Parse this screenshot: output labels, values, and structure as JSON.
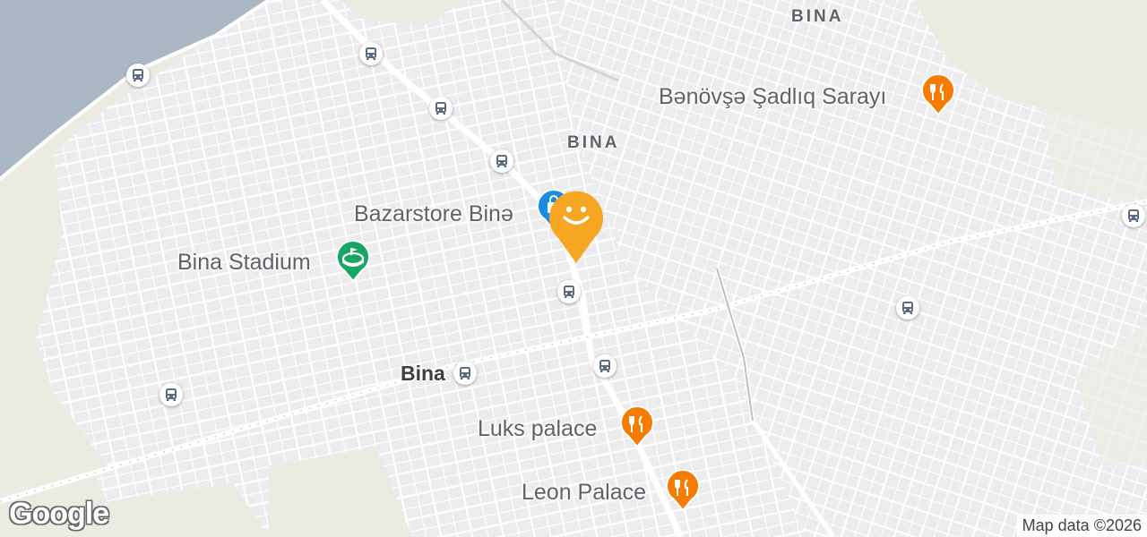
{
  "map": {
    "place_labels": {
      "bazarstore": "Bazarstore Binə",
      "stadium": "Bina Stadium",
      "banovse": "Bənövşə Şadlıq Sarayı",
      "luks": "Luks palace",
      "leon": "Leon Palace"
    },
    "area_labels": {
      "bina_north": "BINA",
      "bina_center": "BINA"
    },
    "station_label": "Bina",
    "icons": {
      "bus": "bus-stop-icon",
      "restaurant": "restaurant-icon",
      "stadium": "stadium-icon",
      "shopping": "shopping-icon",
      "location": "current-location-smiley-icon"
    },
    "colors": {
      "restaurant_pin": "#f57c00",
      "stadium_pin": "#16a765",
      "shopping_pin": "#1a8ce6",
      "location_pin": "#f6a623",
      "water": "#aab7c4",
      "land_beige": "#ecebe2"
    },
    "copyright": "Map data ©2026",
    "logo": "Google"
  }
}
